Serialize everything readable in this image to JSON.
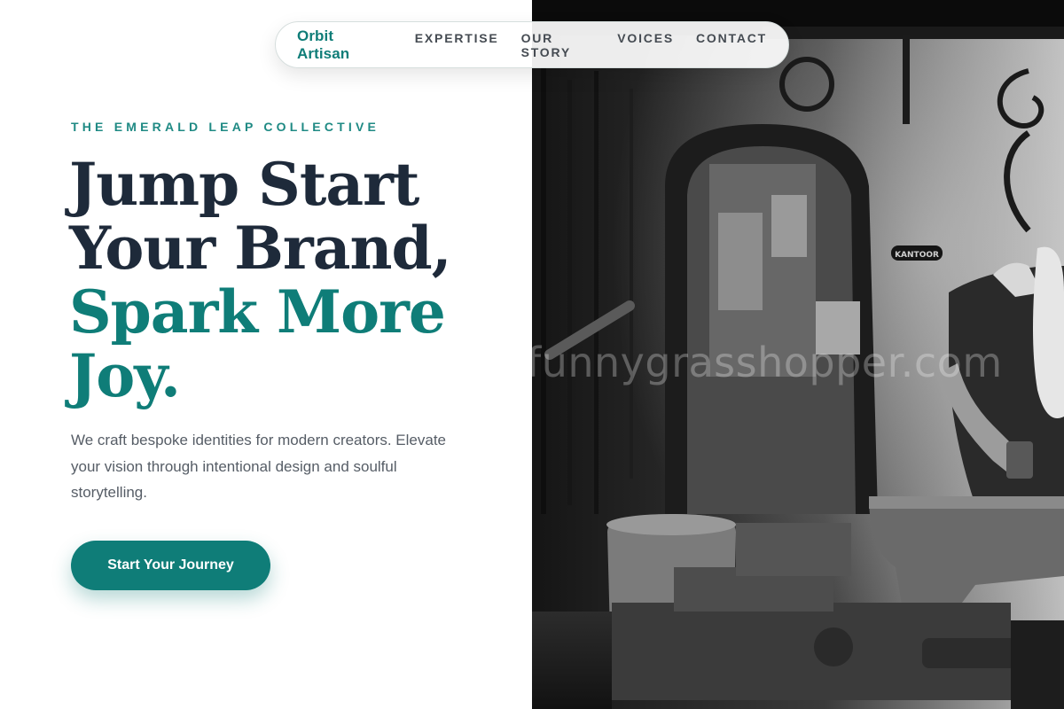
{
  "nav": {
    "brand": "Orbit Artisan",
    "links": [
      "EXPERTISE",
      "OUR STORY",
      "VOICES",
      "CONTACT"
    ]
  },
  "hero": {
    "eyebrow": "THE EMERALD LEAP COLLECTIVE",
    "headline_line1": "Jump Start",
    "headline_line2": "Your Brand,",
    "headline_accent_line1": "Spark More",
    "headline_accent_line2": "Joy.",
    "description": "We craft bespoke identities for modern creators. Elevate your vision through intentional design and soulful storytelling.",
    "cta_label": "Start Your Journey"
  },
  "photo": {
    "watermark": "funnygrasshopper.com",
    "sign_text": "KANTOOR"
  },
  "colors": {
    "accent": "#0f7d78",
    "heading": "#1e2a3a",
    "body_text": "#565d66",
    "nav_text": "#454b52"
  }
}
